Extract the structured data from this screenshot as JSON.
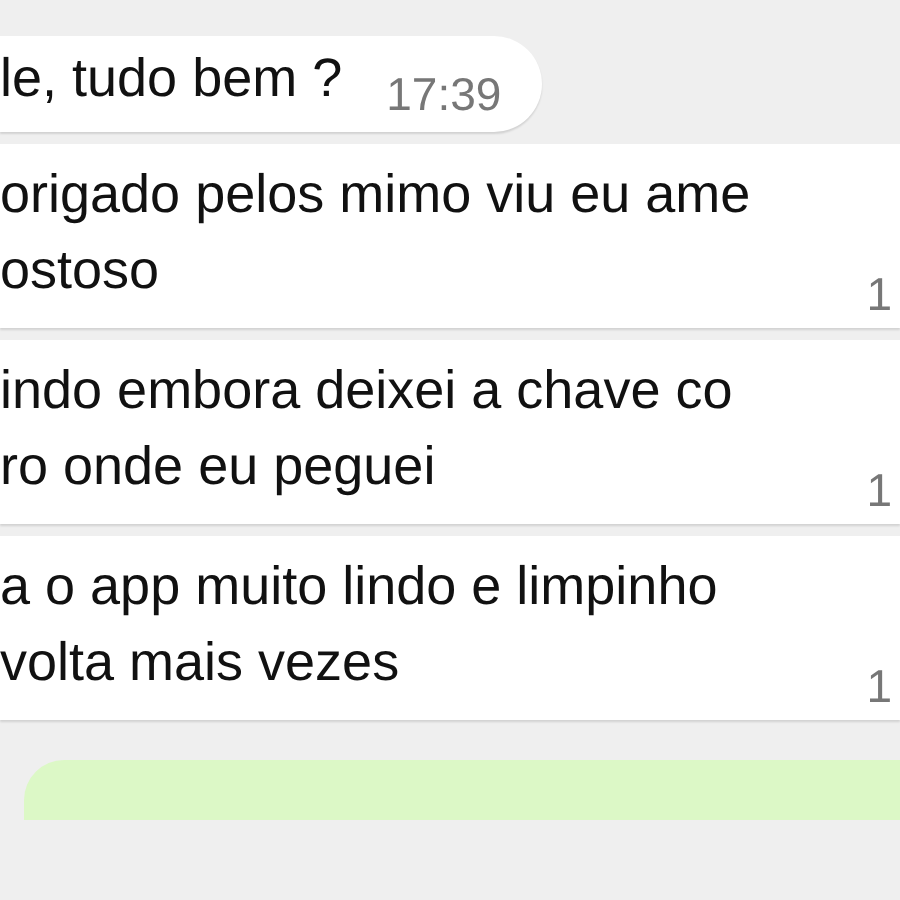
{
  "messages": [
    {
      "kind": "inline",
      "lines": [
        "le, tudo bem ?"
      ],
      "time": "17:39"
    },
    {
      "kind": "block",
      "lines": [
        "origado pelos mimo viu eu ame",
        "ostoso"
      ],
      "time": "1"
    },
    {
      "kind": "block",
      "lines": [
        "indo embora deixei a chave co",
        "ro onde eu peguei"
      ],
      "time": "1"
    },
    {
      "kind": "block",
      "lines": [
        "a o app muito lindo e limpinho",
        "volta mais vezes"
      ],
      "time": "1"
    },
    {
      "kind": "outgoing"
    }
  ]
}
